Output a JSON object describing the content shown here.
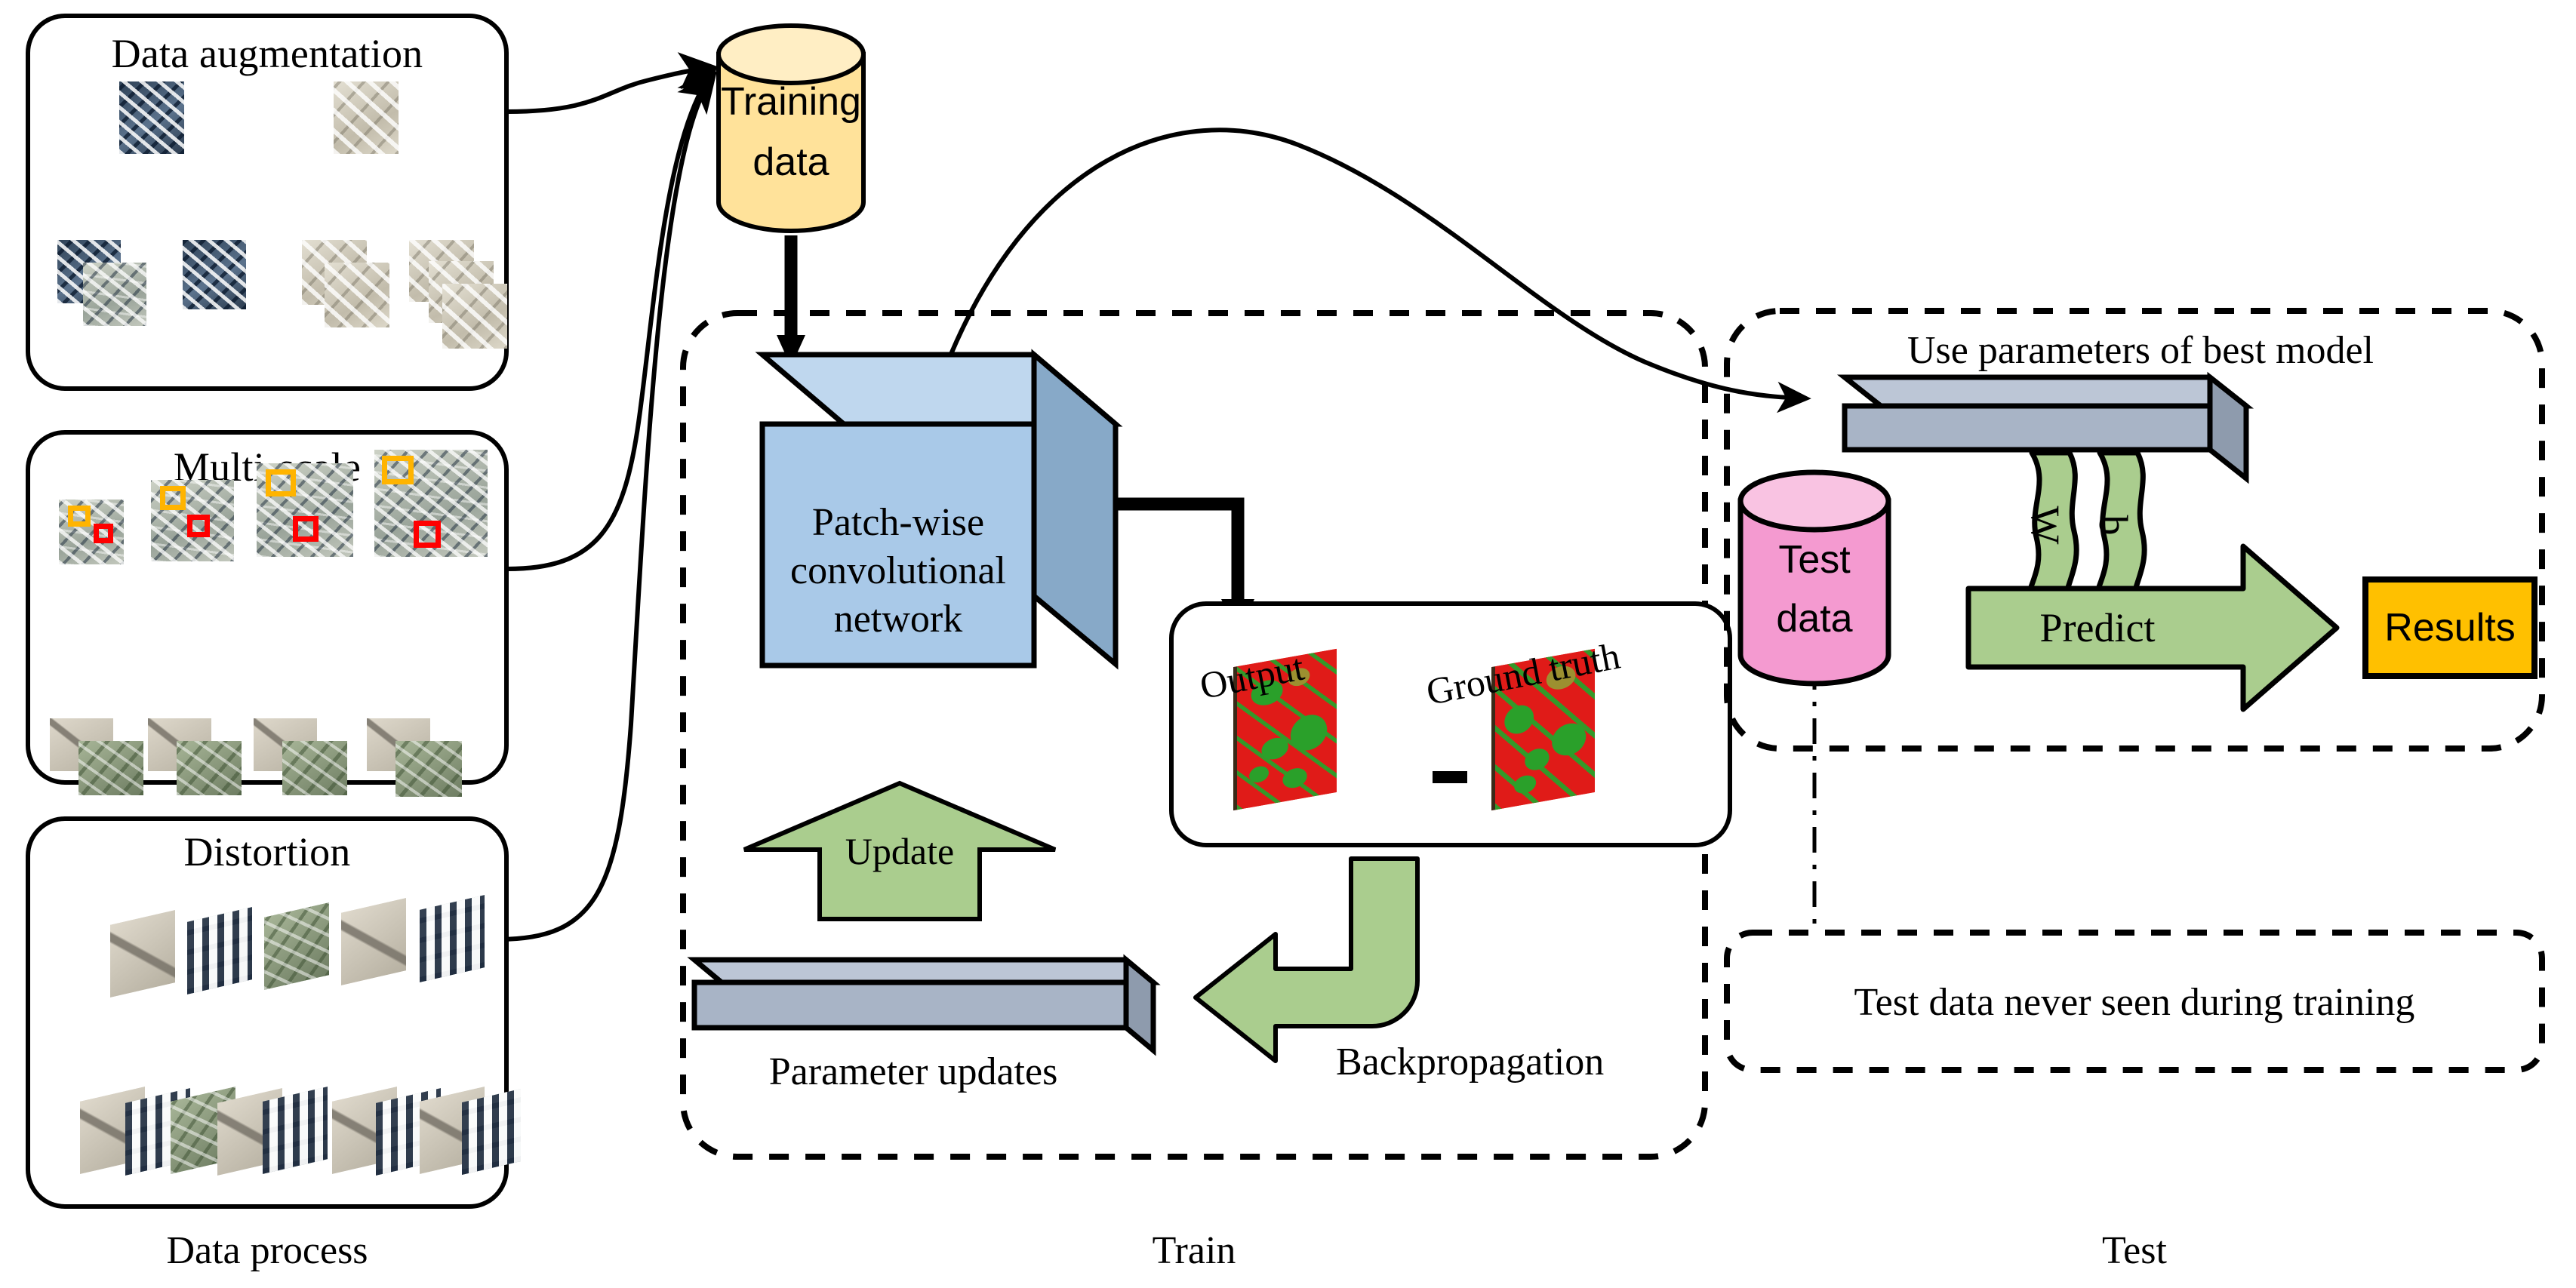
{
  "panels": {
    "data_augmentation": {
      "title": "Data augmentation"
    },
    "multi_scale": {
      "title": "Multi-scale"
    },
    "distortion": {
      "title": "Distortion"
    },
    "train_box": {},
    "compare_box": {},
    "test_box": {},
    "note_box": {
      "text": "Test data never seen during training"
    }
  },
  "section_labels": {
    "data_process": "Data process",
    "train": "Train",
    "test": "Test"
  },
  "nodes": {
    "training_data": {
      "label_line1": "Training",
      "label_line2": "data",
      "fill": "#FFE29A",
      "top_fill": "#FFEEC4"
    },
    "cnn": {
      "label_line1": "Patch-wise",
      "label_line2": "convolutional",
      "label_line3": "network",
      "fill": "#A9C9E8",
      "top_fill": "#BFD7EE",
      "side_fill": "#87A9C8"
    },
    "update_arrow": {
      "label": "Update",
      "fill": "#AACD8E"
    },
    "parameter_updates_bar": {
      "fill": "#A8B4C6",
      "top_fill": "#BCC6D6"
    },
    "parameter_updates_label": "Parameter updates",
    "output_map": {
      "label": "Output"
    },
    "ground_truth_map": {
      "label": "Ground truth"
    },
    "minus_sign": "—",
    "backprop_arrow": {
      "label": "Backpropagation",
      "fill": "#AACD8E"
    },
    "best_model_label": "Use parameters of best model",
    "best_model_bar": {
      "fill": "#A8B4C6",
      "top_fill": "#BCC6D6"
    },
    "test_data": {
      "label_line1": "Test",
      "label_line2": "data",
      "fill": "#F49AD0",
      "top_fill": "#F9C3E2"
    },
    "weight_banner": {
      "label": "W",
      "fill": "#AACD8E"
    },
    "bias_banner": {
      "label": "b",
      "fill": "#AACD8E"
    },
    "predict_arrow": {
      "label": "Predict",
      "fill": "#AACD8E"
    },
    "results_box": {
      "label": "Results",
      "fill": "#FFC000"
    }
  },
  "colors": {
    "stroke": "#000000",
    "green": "#AACD8E",
    "blue": "#A9C9E8",
    "steel": "#A8B4C6",
    "amber": "#FFC000",
    "cream": "#FFE29A",
    "pink": "#F49AD0",
    "seg_red": "#E01B18",
    "seg_green": "#2AA02A",
    "multi_scale_box_outer": "#FFB400",
    "multi_scale_box_inner": "#FF0000"
  },
  "tile_counts": {
    "augmentation_sources": 2,
    "augmentation_results": 4,
    "multiscale_columns": 4,
    "distortion_sources": 5,
    "distortion_results": 2
  }
}
